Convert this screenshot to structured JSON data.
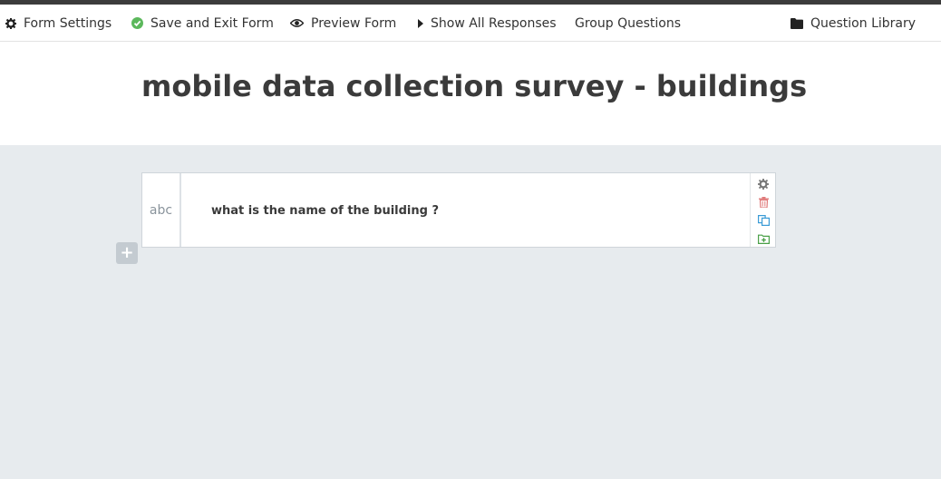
{
  "toolbar": {
    "form_settings": "Form Settings",
    "save_exit": "Save and Exit Form",
    "preview": "Preview Form",
    "show_responses": "Show All Responses",
    "group_questions": "Group Questions",
    "question_library": "Question Library"
  },
  "form": {
    "title": "mobile data collection survey - buildings"
  },
  "question": {
    "type_label": "abc",
    "text": "what is the name of the building ?"
  },
  "add_button": {
    "label": "+"
  },
  "colors": {
    "accent_green": "#5cb85c",
    "delete_red": "#e07b7b",
    "duplicate_blue": "#3a9bd6",
    "library_green": "#4aa048"
  }
}
